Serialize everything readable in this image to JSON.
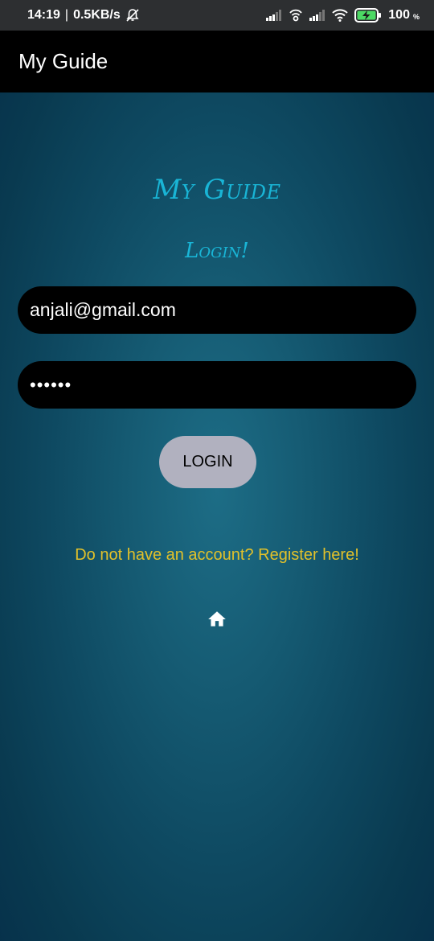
{
  "status_bar": {
    "time": "14:19",
    "separator": "|",
    "network_speed": "0.5KB/s",
    "battery_percent": "100",
    "battery_unit": "%",
    "icons": [
      "alarm-off-icon",
      "cell-signal-icon",
      "hotspot-icon",
      "cell-signal-icon",
      "wifi-icon",
      "battery-charging-icon"
    ]
  },
  "app_bar": {
    "title": "My Guide"
  },
  "login": {
    "logo_title": "My Guide",
    "subtitle": "Login!",
    "email_value": "anjali@gmail.com",
    "password_value": "••••••",
    "login_button": "LOGIN",
    "register_link": "Do not have an account? Register here!"
  },
  "colors": {
    "accent_title": "#19b5d6",
    "link": "#e2c12a",
    "button_bg": "#b1b1bf",
    "field_bg": "#000000",
    "app_bar_bg": "#000000"
  },
  "icons": {
    "home": "home-icon"
  }
}
